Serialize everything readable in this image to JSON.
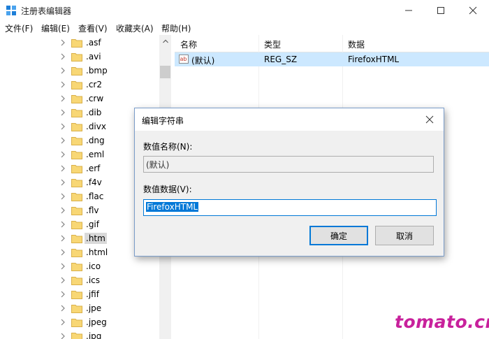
{
  "window": {
    "title": "注册表编辑器",
    "icon": "regedit-icon"
  },
  "menu": [
    "文件(F)",
    "编辑(E)",
    "查看(V)",
    "收藏夹(A)",
    "帮助(H)"
  ],
  "tree": {
    "items": [
      ".asf",
      ".avi",
      ".bmp",
      ".cr2",
      ".crw",
      ".dib",
      ".divx",
      ".dng",
      ".eml",
      ".erf",
      ".f4v",
      ".flac",
      ".flv",
      ".gif",
      ".htm",
      ".html",
      ".ico",
      ".ics",
      ".jfif",
      ".jpe",
      ".jpeg",
      ".jpg"
    ],
    "selected": ".htm"
  },
  "list": {
    "columns": [
      "名称",
      "类型",
      "数据"
    ],
    "rows": [
      {
        "name": "(默认)",
        "type": "REG_SZ",
        "data": "FirefoxHTML"
      }
    ],
    "selected_color": "#cce8ff"
  },
  "dialog": {
    "title": "编辑字符串",
    "name_label": "数值名称(N):",
    "name_value": "(默认)",
    "data_label": "数值数据(V):",
    "data_value": "FirefoxHTML",
    "ok_label": "确定",
    "cancel_label": "取消",
    "accent": "#0078d7"
  },
  "watermark": "tomato.cm"
}
